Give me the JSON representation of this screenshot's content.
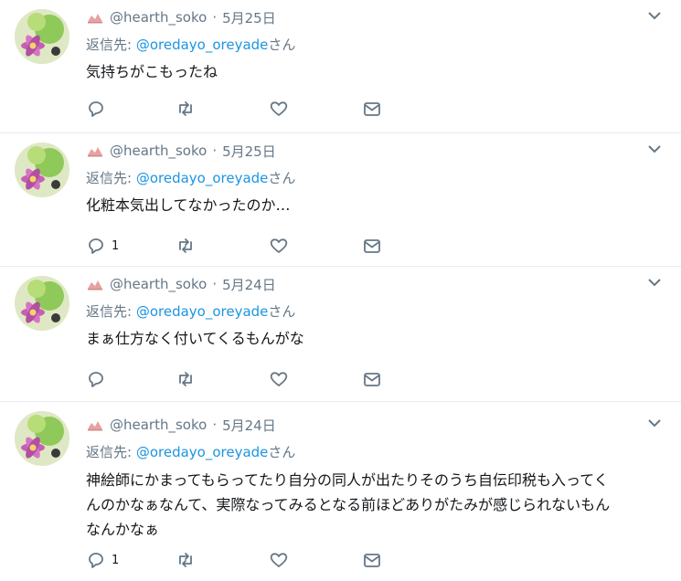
{
  "tweets": [
    {
      "handle": "@hearth_soko",
      "date": "5月25日",
      "reply_prefix": "返信先: ",
      "reply_mention": "@oredayo_oreyade",
      "reply_suffix": "さん",
      "text_lines": [
        "気持ちがこもったね"
      ],
      "reply_count": ""
    },
    {
      "handle": "@hearth_soko",
      "date": "5月25日",
      "reply_prefix": "返信先: ",
      "reply_mention": "@oredayo_oreyade",
      "reply_suffix": "さん",
      "text_lines": [
        "化粧本気出してなかったのか…"
      ],
      "reply_count": "1"
    },
    {
      "handle": "@hearth_soko",
      "date": "5月24日",
      "reply_prefix": "返信先: ",
      "reply_mention": "@oredayo_oreyade",
      "reply_suffix": "さん",
      "text_lines": [
        "まぁ仕方なく付いてくるもんがな"
      ],
      "reply_count": ""
    },
    {
      "handle": "@hearth_soko",
      "date": "5月24日",
      "reply_prefix": "返信先: ",
      "reply_mention": "@oredayo_oreyade",
      "reply_suffix": "さん",
      "text_lines": [
        "神絵師にかまってもらってたり自分の同人が出たりそのうち自伝印税も入ってく",
        "んのかなぁなんて、実際なってみるとなる前ほどありがたみが感じられないもん",
        "なんかなぁ"
      ],
      "reply_count": "1"
    }
  ],
  "icons": {
    "reply": "reply-icon",
    "retweet": "retweet-icon",
    "like": "heart-icon",
    "dm": "envelope-icon",
    "caret": "chevron-down-icon"
  },
  "colors": {
    "muted": "#657786",
    "mention": "#1b95e0",
    "text": "#14171a",
    "divider": "#e6ecf0"
  }
}
